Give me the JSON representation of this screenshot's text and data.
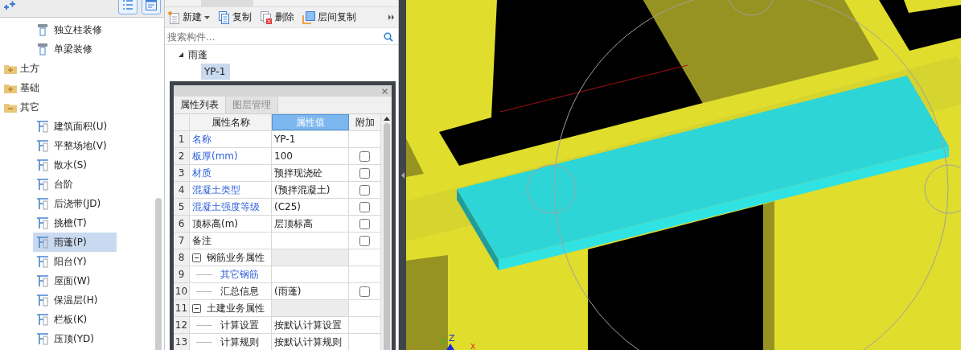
{
  "left_tree": {
    "continued_items": [
      {
        "label": "独立柱装修",
        "selected": false
      },
      {
        "label": "单梁装修",
        "selected": false
      }
    ],
    "groups": [
      {
        "label": "土方",
        "expanded": false
      },
      {
        "label": "基础",
        "expanded": false
      },
      {
        "label": "其它",
        "expanded": true,
        "children": [
          {
            "label": "建筑面积(U)",
            "selected": false
          },
          {
            "label": "平整场地(V)",
            "selected": false
          },
          {
            "label": "散水(S)",
            "selected": false
          },
          {
            "label": "台阶",
            "selected": false
          },
          {
            "label": "后浇带(JD)",
            "selected": false
          },
          {
            "label": "挑檐(T)",
            "selected": false
          },
          {
            "label": "雨蓬(P)",
            "selected": true
          },
          {
            "label": "阳台(Y)",
            "selected": false
          },
          {
            "label": "屋面(W)",
            "selected": false
          },
          {
            "label": "保温层(H)",
            "selected": false
          },
          {
            "label": "栏板(K)",
            "selected": false
          },
          {
            "label": "压顶(YD)",
            "selected": false
          }
        ]
      }
    ]
  },
  "toolbar": [
    {
      "label": "新建",
      "kind": "new",
      "dropdown": true
    },
    {
      "label": "复制",
      "kind": "copy",
      "dropdown": false
    },
    {
      "label": "删除",
      "kind": "delete",
      "dropdown": false
    },
    {
      "label": "层间复制",
      "kind": "floorcopy",
      "dropdown": false
    }
  ],
  "search": {
    "placeholder": "搜索构件..."
  },
  "component_tree": {
    "label": "雨蓬",
    "expanded": true,
    "children": [
      {
        "label": "YP-1",
        "selected": true
      }
    ]
  },
  "properties": {
    "tabs": [
      {
        "label": "属性列表",
        "selected": true
      },
      {
        "label": "图层管理",
        "selected": false
      }
    ],
    "columns": [
      "属性名称",
      "属性值",
      "附加"
    ],
    "rows": [
      {
        "no": "1",
        "name": "名称",
        "value": "YP-1",
        "private": true
      },
      {
        "no": "2",
        "name": "板厚(mm)",
        "value": "100",
        "private": true,
        "checked": false
      },
      {
        "no": "3",
        "name": "材质",
        "value": "预拌现浇砼",
        "private": true,
        "checked": false
      },
      {
        "no": "4",
        "name": "混凝土类型",
        "value": "(预拌混凝土)",
        "private": true,
        "checked": false
      },
      {
        "no": "5",
        "name": "混凝土强度等级",
        "value": "(C25)",
        "private": true,
        "checked": false
      },
      {
        "no": "6",
        "name": "顶标高(m)",
        "value": "层顶标高",
        "private": false,
        "checked": false
      },
      {
        "no": "7",
        "name": "备注",
        "private": false,
        "checked": false
      },
      {
        "no": "8",
        "name": "钢筋业务属性",
        "kind": "group",
        "expanded": true,
        "children": [
          {
            "no": "9",
            "name": "其它钢筋",
            "private": true
          },
          {
            "no": "10",
            "name": "汇总信息",
            "value": "(雨蓬)",
            "private": false,
            "checked": false
          }
        ]
      },
      {
        "no": "11",
        "name": "土建业务属性",
        "kind": "group",
        "expanded": true,
        "children": [
          {
            "no": "12",
            "name": "计算设置",
            "value": "按默认计算设置",
            "private": false
          },
          {
            "no": "13",
            "name": "计算规则",
            "value": "按默认计算规则",
            "private": false
          }
        ]
      }
    ]
  },
  "viewport": {
    "axes": [
      "Z",
      "Y",
      "X"
    ]
  }
}
